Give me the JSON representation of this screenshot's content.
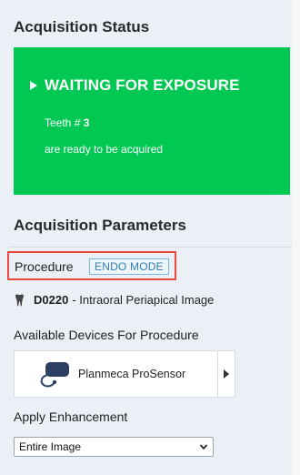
{
  "acquisition_status": {
    "title": "Acquisition Status",
    "message": "WAITING FOR EXPOSURE",
    "teeth_label": "Teeth # ",
    "teeth_number": "3",
    "ready_text": "are ready to be acquired",
    "color": "#00c853"
  },
  "acquisition_parameters": {
    "title": "Acquisition Parameters",
    "procedure_label": "Procedure",
    "mode_badge": "ENDO MODE",
    "procedure_code": "D0220",
    "procedure_description": "- Intraoral Periapical Image",
    "devices_title": "Available Devices For Procedure",
    "device_name": "Planmeca ProSensor",
    "enhancement_title": "Apply Enhancement",
    "enhancement_value": "Entire Image",
    "highlight_color": "#e8493c"
  },
  "icons": {
    "play": "play-icon",
    "tooth": "tooth-icon",
    "sensor": "sensor-icon",
    "next": "chevron-right-icon",
    "dropdown": "chevron-down-icon"
  }
}
